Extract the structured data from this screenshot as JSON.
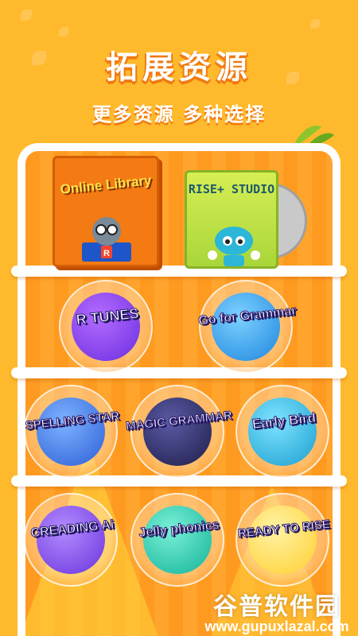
{
  "header": {
    "title": "拓展资源",
    "subtitle": "更多资源 多种选择"
  },
  "featured": {
    "library": {
      "label": "Online Library"
    },
    "studio": {
      "label": "RISE+ STUDIO"
    }
  },
  "apps_row1": [
    {
      "label": "R TUNES",
      "icon": "r-tunes-logo",
      "color": "#7b3df0"
    },
    {
      "label": "Go for Grammar",
      "icon": "go-for-grammar-logo",
      "color": "#2a9de8"
    }
  ],
  "apps_row2": [
    {
      "label": "SPELLING STAR",
      "icon": "spelling-star-logo",
      "color": "#3a6fe0"
    },
    {
      "label": "MAGIC GRAMMAR",
      "icon": "magic-grammar-logo",
      "color": "#2a2a58"
    },
    {
      "label": "Early Bird",
      "icon": "early-bird-logo",
      "color": "#1aa7d6"
    }
  ],
  "apps_row3": [
    {
      "label": "CREADING Ai",
      "icon": "creading-ai-logo",
      "color": "#7a44e6"
    },
    {
      "label": "Jelly phonics",
      "icon": "jelly-phonics-logo",
      "color": "#15c6a8"
    },
    {
      "label": "READY TO RISE",
      "icon": "ready-to-rise-logo",
      "color": "#ffd23a"
    }
  ],
  "watermark": {
    "text": "谷普软件园",
    "url": "www.gupuxlazal.com"
  },
  "colors": {
    "background": "#ffb92c",
    "shelf": "#ff9a20",
    "accent_shadow": "#f07a12"
  }
}
